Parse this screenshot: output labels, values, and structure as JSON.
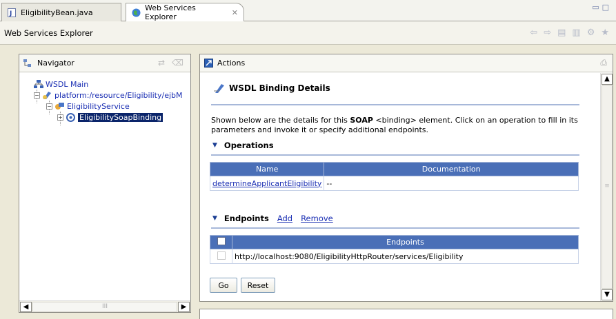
{
  "tabs": [
    {
      "label": "EligibilityBean.java",
      "icon": "java-file-icon"
    },
    {
      "label": "Web Services Explorer",
      "icon": "globe-icon",
      "close": "✕"
    }
  ],
  "window_controls": "▭ ▭",
  "header": {
    "title": "Web Services Explorer"
  },
  "navigator": {
    "title": "Navigator",
    "tree": [
      {
        "label": "WSDL Main"
      },
      {
        "label": "platform:/resource/Eligibility/ejbM"
      },
      {
        "label": "EligibilityService"
      },
      {
        "label": "EligibilitySoapBinding"
      }
    ],
    "scroll_thumb": "III"
  },
  "actions": {
    "title": "Actions",
    "section_title": "WSDL Binding Details",
    "desc_pre": "Shown below are the details for this ",
    "desc_bold": "SOAP",
    "desc_post": " <binding> element. Click on an operation to fill in its parameters and invoke it or specify additional endpoints.",
    "operations": {
      "heading": "Operations",
      "columns": [
        "Name",
        "Documentation"
      ],
      "rows": [
        {
          "name": "determineApplicantEligibility",
          "doc": "--"
        }
      ]
    },
    "endpoints": {
      "heading": "Endpoints",
      "add": "Add",
      "remove": "Remove",
      "column": "Endpoints",
      "rows": [
        "http://localhost:9080/EligibilityHttpRouter/services/Eligibility"
      ]
    },
    "go": "Go",
    "reset": "Reset"
  }
}
